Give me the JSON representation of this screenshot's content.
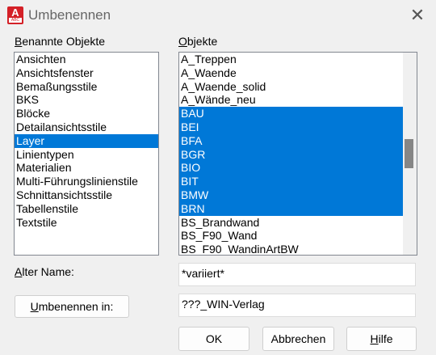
{
  "window": {
    "title": "Umbenennen",
    "icon_letter": "A",
    "icon_sub": "ABC"
  },
  "left": {
    "label_prefix": "B",
    "label_rest": "enannte Objekte",
    "items": [
      "Ansichten",
      "Ansichtsfenster",
      "Bemaßungsstile",
      "BKS",
      "Blöcke",
      "Detailansichtsstile",
      "Layer",
      "Linientypen",
      "Materialien",
      "Multi-Führungslinienstile",
      "Schnittansichtsstile",
      "Tabellenstile",
      "Textstile"
    ],
    "selected_index": 6
  },
  "right": {
    "label_prefix": "O",
    "label_rest": "bjekte",
    "items": [
      "A_Treppen",
      "A_Waende",
      "A_Waende_solid",
      "A_Wände_neu",
      "BAU",
      "BEI",
      "BFA",
      "BGR",
      "BIO",
      "BIT",
      "BMW",
      "BRN",
      "BS_Brandwand",
      "BS_F90_Wand",
      "BS_F90_WandinArtBW"
    ],
    "selected_indices": [
      4,
      5,
      6,
      7,
      8,
      9,
      10,
      11
    ]
  },
  "old_name": {
    "label_prefix": "A",
    "label_rest": "lter Name:",
    "value": "*variiert*"
  },
  "rename": {
    "button_prefix": "U",
    "button_rest": "mbenennen in:",
    "value": "???_WIN-Verlag"
  },
  "buttons": {
    "ok": "OK",
    "cancel": "Abbrechen",
    "help_prefix": "H",
    "help_rest": "ilfe"
  },
  "colors": {
    "selection": "#0078d7",
    "icon_red": "#d42027"
  },
  "icons": {
    "close": "close-icon",
    "app": "autocad-rename-icon"
  }
}
